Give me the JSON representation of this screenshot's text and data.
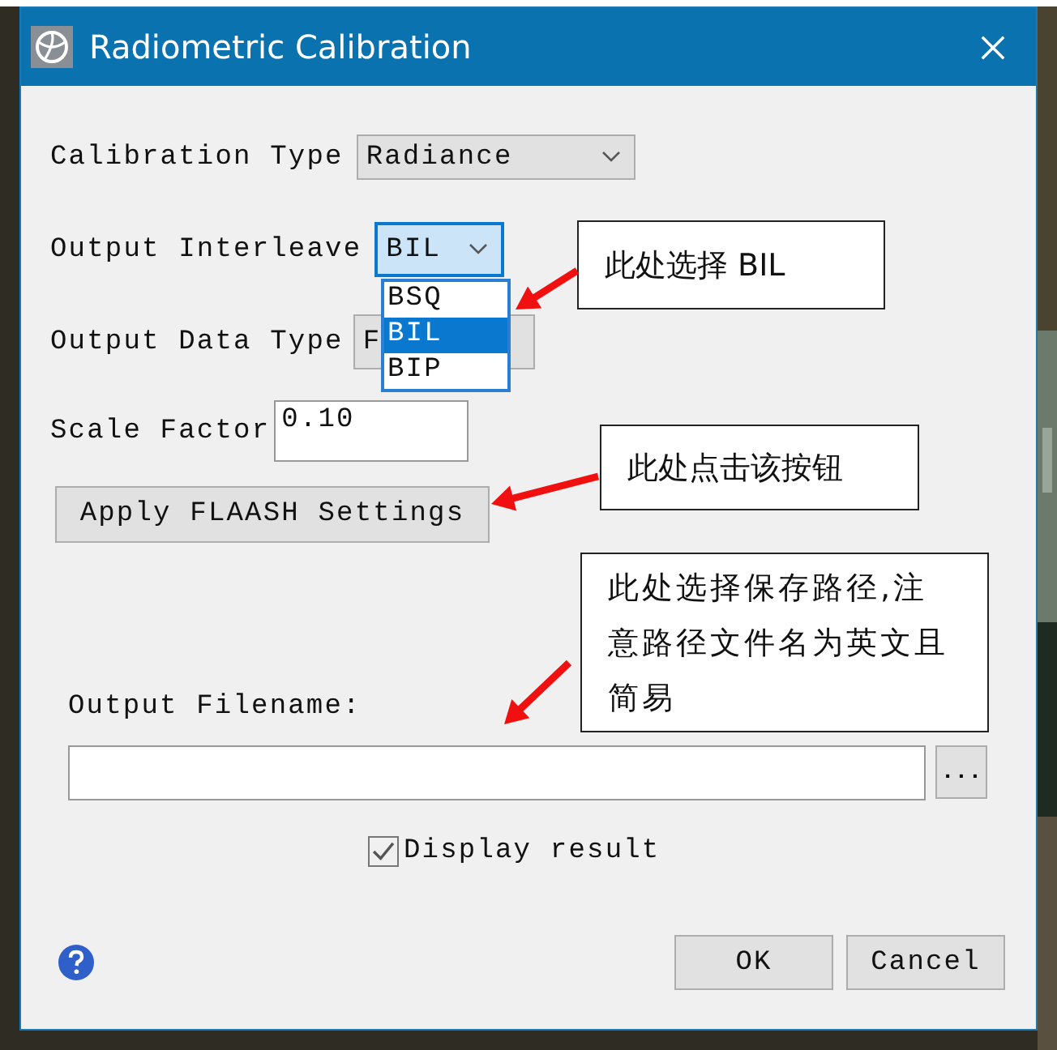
{
  "window": {
    "title": "Radiometric Calibration"
  },
  "fields": [
    {
      "kind": "select",
      "label": "Calibration Type",
      "value": "Radiance",
      "focused": false
    },
    {
      "kind": "select",
      "label": "Output Interleave",
      "value": "BIL",
      "focused": true
    },
    {
      "kind": "select",
      "label": "Output Data Type",
      "value": "F",
      "focused": false
    },
    {
      "kind": "input",
      "label": "Scale Factor",
      "value": "0.10"
    }
  ],
  "dropdown_list": {
    "options": [
      {
        "label": "BSQ",
        "selected": false
      },
      {
        "label": "BIL",
        "selected": true
      },
      {
        "label": "BIP",
        "selected": false
      }
    ]
  },
  "apply_button": "Apply FLAASH Settings",
  "output_filename": {
    "label": "Output Filename:",
    "browse_button": "..."
  },
  "display_result": {
    "label": "Display result",
    "checked": true
  },
  "buttons": [
    "OK",
    "Cancel"
  ],
  "annotations": [
    {
      "text": "此处选择 BIL"
    },
    {
      "text": "此处点击该按钮"
    },
    {
      "text": "此处选择保存路径,注意路径文件名为英文且简易"
    }
  ]
}
